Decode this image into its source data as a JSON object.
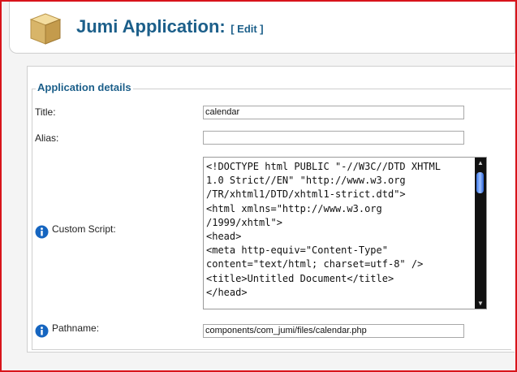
{
  "header": {
    "title": "Jumi Application:",
    "edit_label": "[ Edit ]",
    "box_icon": "box-icon"
  },
  "form": {
    "legend": "Application details",
    "title_label": "Title:",
    "title_value": "calendar",
    "alias_label": "Alias:",
    "alias_value": "",
    "custom_script_label": "Custom Script:",
    "custom_script_value": "<!DOCTYPE html PUBLIC \"-//W3C//DTD XHTML\n1.0 Strict//EN\" \"http://www.w3.org\n/TR/xhtml1/DTD/xhtml1-strict.dtd\">\n<html xmlns=\"http://www.w3.org\n/1999/xhtml\">\n<head>\n<meta http-equiv=\"Content-Type\"\ncontent=\"text/html; charset=utf-8\" />\n<title>Untitled Document</title>\n</head>",
    "pathname_label": "Pathname:",
    "pathname_value": "components/com_jumi/files/calendar.php",
    "info_icon": "info-icon"
  },
  "colors": {
    "title": "#1c5f8a",
    "frame_border": "#d8141b",
    "info_icon": "#1565c0",
    "scroll_thumb": "#3b77e8"
  }
}
